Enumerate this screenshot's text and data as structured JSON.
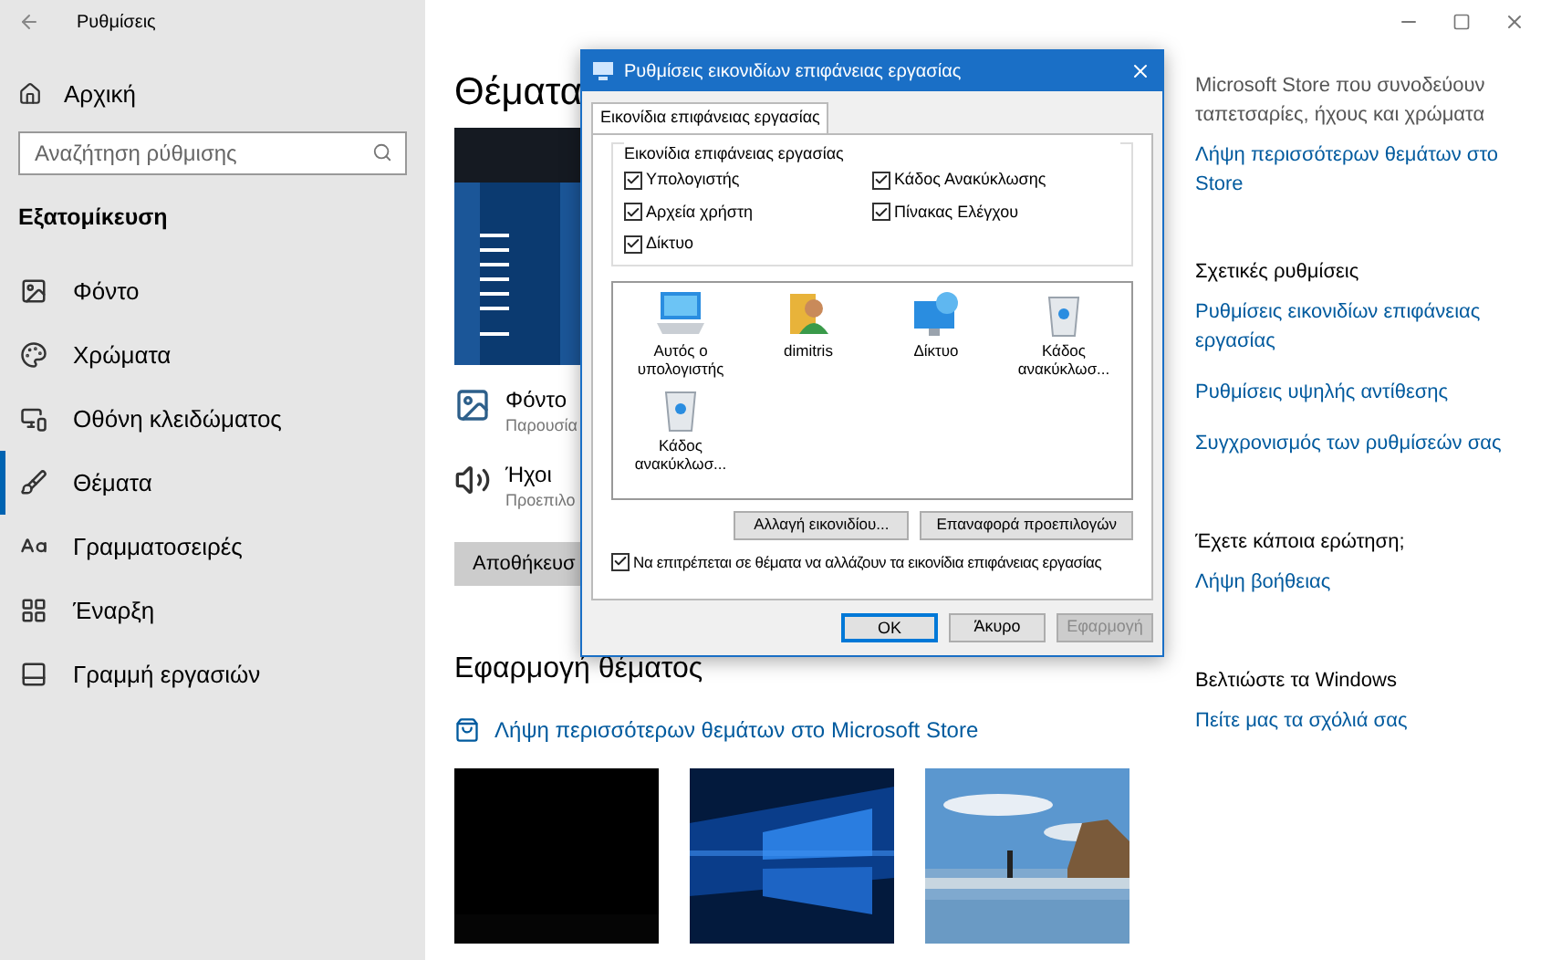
{
  "window": {
    "title": "Ρυθμίσεις"
  },
  "sidebar": {
    "home": "Αρχική",
    "search": {
      "placeholder": "Αναζήτηση ρύθμισης"
    },
    "section": "Εξατομίκευση",
    "items": [
      {
        "kind": "background",
        "label": "Φόντο",
        "selected": false
      },
      {
        "kind": "colors",
        "label": "Χρώματα",
        "selected": false
      },
      {
        "kind": "lock",
        "label": "Οθόνη κλειδώματος",
        "selected": false
      },
      {
        "kind": "themes",
        "label": "Θέματα",
        "selected": true
      },
      {
        "kind": "fonts",
        "label": "Γραμματοσειρές",
        "selected": false
      },
      {
        "kind": "start",
        "label": "Έναρξη",
        "selected": false
      },
      {
        "kind": "taskbar",
        "label": "Γραμμή εργασιών",
        "selected": false
      }
    ]
  },
  "main": {
    "heading": "Θέματα",
    "settings": [
      {
        "kind": "background",
        "title": "Φόντο",
        "value": "Παρουσία"
      },
      {
        "kind": "sound",
        "title": "Ήχοι",
        "value": "Προεπιλο"
      }
    ],
    "save_button": "Αποθήκευσ",
    "apply_heading": "Εφαρμογή θέματος",
    "store_link": "Λήψη περισσότερων θεμάτων στο Microsoft Store",
    "themes": [
      {
        "kind": "black"
      },
      {
        "kind": "windows"
      },
      {
        "kind": "picture"
      }
    ]
  },
  "right_panel": {
    "intro": "Microsoft Store που συνοδεύουν ταπετσαρίες, ήχους και χρώματα",
    "store_link": "Λήψη περισσότερων θεμάτων στο Store",
    "sections": [
      {
        "title": "Σχετικές ρυθμίσεις",
        "links": [
          "Ρυθμίσεις εικονιδίων επιφάνειας εργασίας",
          "Ρυθμίσεις υψηλής αντίθεσης",
          "Συγχρονισμός των ρυθμίσεών σας"
        ]
      },
      {
        "title": "Έχετε κάποια ερώτηση;",
        "links": [
          "Λήψη βοήθειας"
        ]
      },
      {
        "title": "Βελτιώστε τα Windows",
        "links": [
          "Πείτε μας τα σχόλιά σας"
        ]
      }
    ]
  },
  "dialog": {
    "title": "Ρυθμίσεις εικονιδίων επιφάνειας εργασίας",
    "tabs": [
      {
        "label": "Εικονίδια επιφάνειας εργασίας",
        "selected": true
      }
    ],
    "group_title": "Εικονίδια επιφάνειας εργασίας",
    "checkboxes": [
      {
        "label": "Υπολογιστής",
        "checked": true
      },
      {
        "label": "Κάδος Ανακύκλωσης",
        "checked": true
      },
      {
        "label": "Αρχεία χρήστη",
        "checked": true
      },
      {
        "label": "Πίνακας Ελέγχου",
        "checked": true
      },
      {
        "label": "Δίκτυο",
        "checked": true
      }
    ],
    "icons": [
      {
        "kind": "computer",
        "label": "Αυτός ο υπολογιστής",
        "selected": false
      },
      {
        "kind": "user",
        "label": "dimitris",
        "selected": false
      },
      {
        "kind": "network",
        "label": "Δίκτυο",
        "selected": false
      },
      {
        "kind": "bin",
        "label": "Κάδος ανακύκλωσ...",
        "selected": false
      },
      {
        "kind": "bin",
        "label": "Κάδος ανακύκλωσ...",
        "selected": false
      }
    ],
    "change_icon_button": "Αλλαγή εικονιδίου...",
    "restore_button": "Επαναφορά προεπιλογών",
    "allow_themes": {
      "label": "Να επιτρέπεται σε θέματα να αλλάζουν τα εικονίδια επιφάνειας εργασίας",
      "checked": true
    },
    "buttons": [
      {
        "label": "OK",
        "default": true,
        "disabled": false
      },
      {
        "label": "Άκυρο",
        "default": false,
        "disabled": false
      },
      {
        "label": "Εφαρμογή",
        "default": false,
        "disabled": true
      }
    ]
  }
}
